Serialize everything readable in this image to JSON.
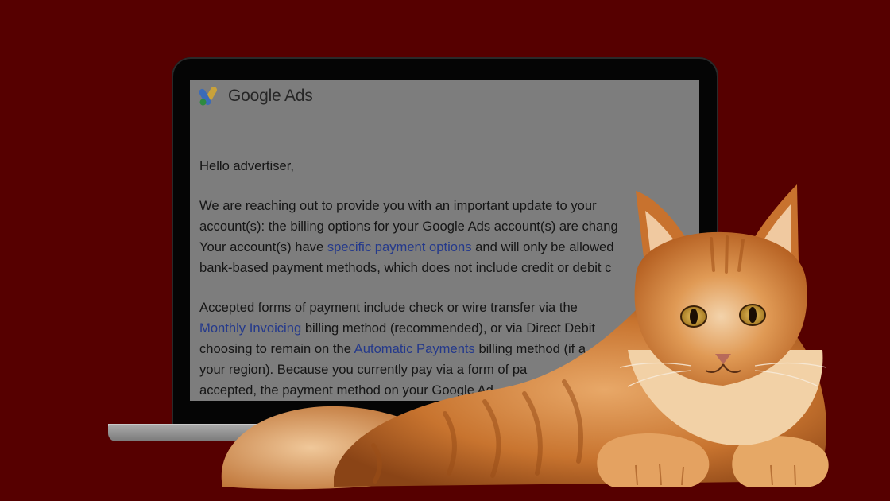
{
  "email": {
    "brand": "Google Ads",
    "greeting": "Hello advertiser,",
    "p1": [
      "We are reaching out to provide you with an important update to your",
      "account(s): the billing options for your Google Ads account(s) are chang",
      [
        "Your account(s) have ",
        "specific payment options",
        " and will only be allowed"
      ],
      "bank-based payment methods, which does not include credit or debit c"
    ],
    "p2": [
      "Accepted forms of payment include check or wire transfer via the",
      [
        "",
        "Monthly Invoicing",
        " billing method (recommended), or via Direct Debit"
      ],
      [
        "choosing to remain on the ",
        "Automatic Payments",
        " billing method (if a"
      ],
      "your region). Because you currently pay via a form of pa",
      "accepted, the payment method on your Google Ad"
    ]
  },
  "colors": {
    "background": "#560000",
    "screen": "#7d7d7d",
    "link": "#24398b",
    "cat_fur": "#d2803a"
  }
}
